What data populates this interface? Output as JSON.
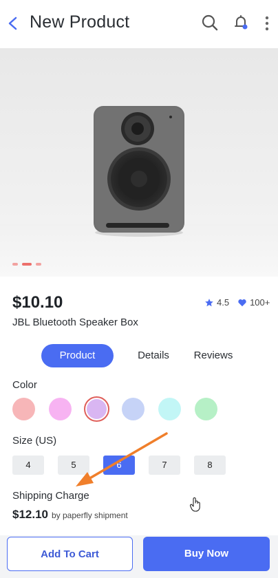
{
  "header": {
    "title": "New Product"
  },
  "gallery": {
    "dots": 3,
    "active_dot": 1
  },
  "product": {
    "price": "$10.10",
    "name": "JBL Bluetooth Speaker Box",
    "rating": "4.5",
    "likes": "100+"
  },
  "tabs": [
    {
      "label": "Product"
    },
    {
      "label": "Details"
    },
    {
      "label": "Reviews"
    }
  ],
  "color": {
    "label": "Color",
    "swatches": [
      "#f7b6b8",
      "#f7b3f2",
      "#d9b6f2",
      "#c6d3f7",
      "#c2f6f6",
      "#b6f0c6"
    ],
    "selected_index": 2
  },
  "size": {
    "label": "Size (US)",
    "options": [
      "4",
      "5",
      "6",
      "7",
      "8"
    ],
    "selected": "6"
  },
  "shipping": {
    "label": "Shipping Charge",
    "price": "$12.10",
    "note": "by paperfly shipment"
  },
  "actions": {
    "add_to_cart": "Add To Cart",
    "buy_now": "Buy Now"
  },
  "colors": {
    "accent": "#4a6cf2",
    "arrow": "#f07f2b"
  }
}
